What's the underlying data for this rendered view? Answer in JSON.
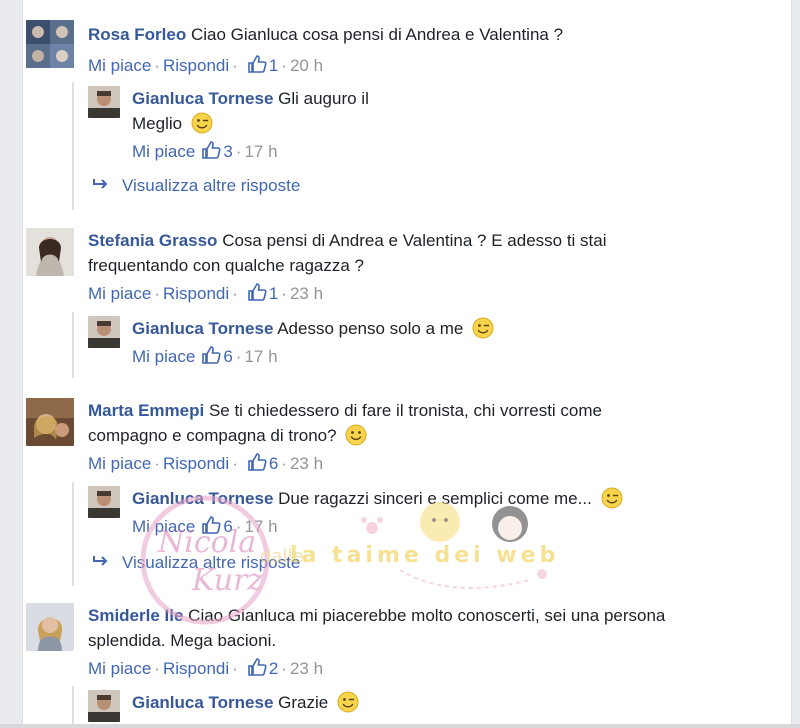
{
  "labels": {
    "like": "Mi piace",
    "reply": "Rispondi",
    "separator": "·",
    "view_more": "Visualizza altre risposte"
  },
  "comments": [
    {
      "author": "Rosa Forleo",
      "text_line1": "Ciao Gianluca cosa pensi di Andrea e Valentina ?",
      "text_line2": "",
      "likes": "1",
      "time": "20 h",
      "reply": {
        "author": "Gianluca Tornese",
        "text_line1": "Gli auguro il",
        "text_line2": "Meglio",
        "likes": "3",
        "time": "17 h"
      }
    },
    {
      "author": "Stefania Grasso",
      "text_line1": "Cosa pensi di Andrea e Valentina ? E adesso ti stai",
      "text_line2": "frequentando con qualche ragazza ?",
      "likes": "1",
      "time": "23 h",
      "reply": {
        "author": "Gianluca Tornese",
        "text_line1": "Adesso penso solo a me",
        "text_line2": "",
        "likes": "6",
        "time": "17 h"
      }
    },
    {
      "author": "Marta Emmepi",
      "text_line1": "Se ti chiedessero di fare il tronista, chi vorresti come",
      "text_line2": "compagno e compagna di trono?",
      "likes": "6",
      "time": "23 h",
      "reply": {
        "author": "Gianluca Tornese",
        "text_line1": "Due ragazzi sinceri e semplici come me...",
        "text_line2": "",
        "likes": "6",
        "time": "17 h"
      }
    },
    {
      "author": "Smiderle Ile",
      "text_line1": "Ciao Gianluca mi piacerebbe molto conoscerti, sei una persona",
      "text_line2": "splendida. Mega bacioni.",
      "likes": "2",
      "time": "23 h",
      "reply": {
        "author": "Gianluca Tornese",
        "text_line1": "Grazie",
        "text_line2": "",
        "likes": "",
        "time": ""
      }
    }
  ],
  "watermark": {
    "text": "Nicola Nicolo Kurz"
  },
  "colors": {
    "name": "#365899",
    "link": "#4267b2",
    "meta": "#90949c",
    "text": "#1d2129"
  }
}
